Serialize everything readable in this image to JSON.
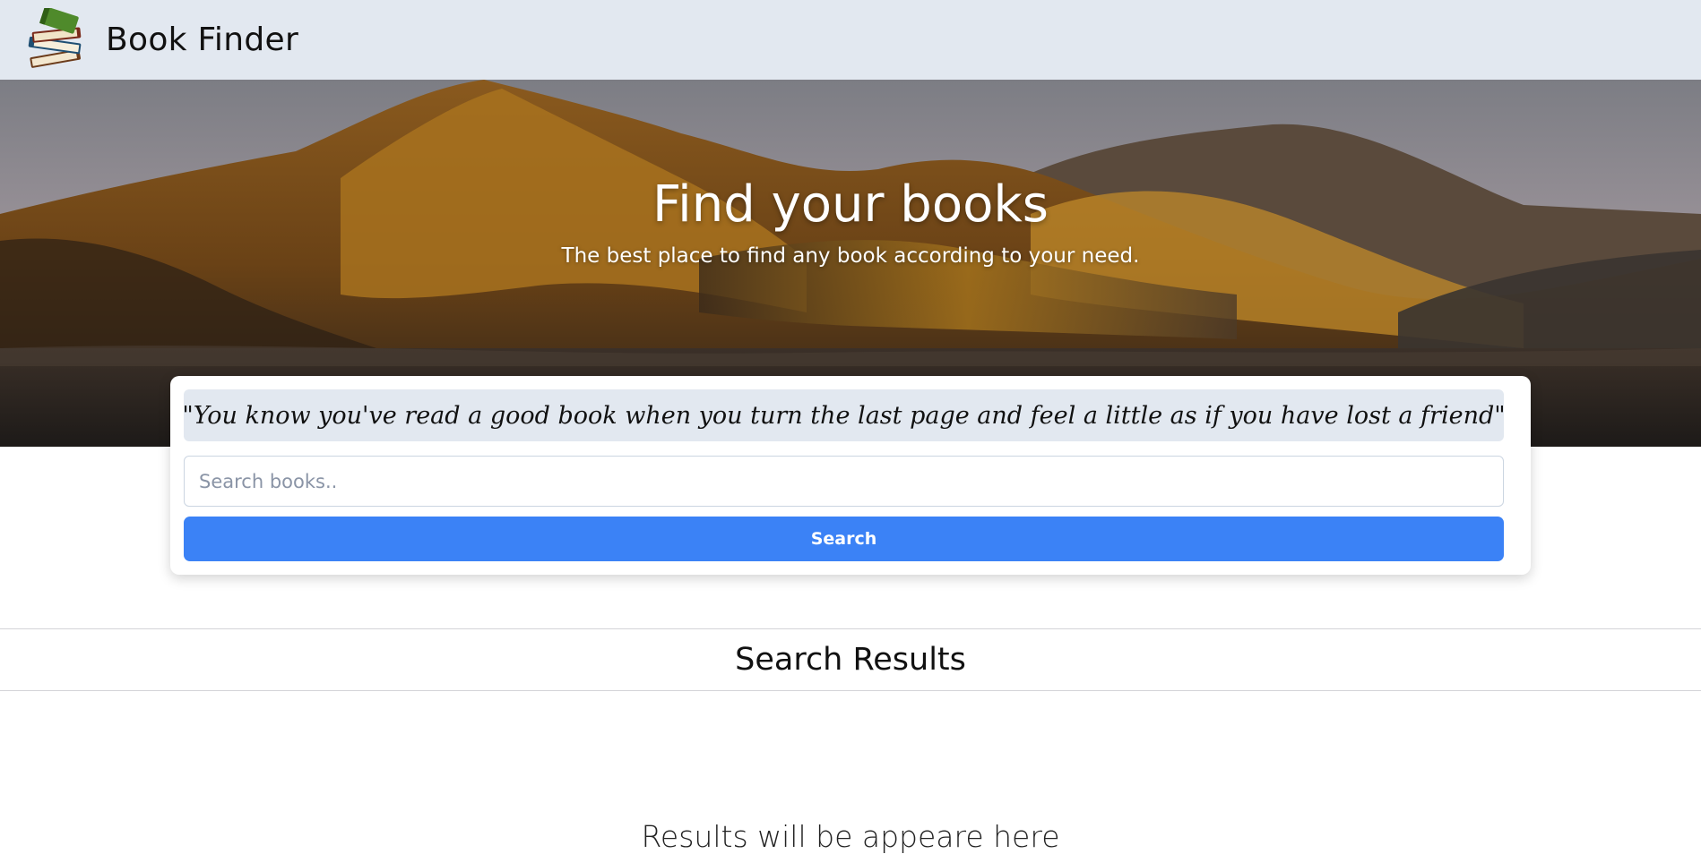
{
  "header": {
    "logo_icon": "stacked-books-icon",
    "title": "Book Finder"
  },
  "hero": {
    "title": "Find your books",
    "subtitle": "The best place to find any book according to your need."
  },
  "search_card": {
    "quote": "\"You know you've read a good book when you turn the last page and feel a little as if you have lost a friend\"",
    "search_placeholder": "Search books..",
    "search_value": "",
    "search_button_label": "Search"
  },
  "results": {
    "heading": "Search Results",
    "placeholder_text": "Results will be appeare here"
  },
  "colors": {
    "header_bg": "#e2e8f0",
    "quote_bg": "#e2e8f0",
    "button_bg": "#3b82f6",
    "button_text": "#ffffff"
  }
}
